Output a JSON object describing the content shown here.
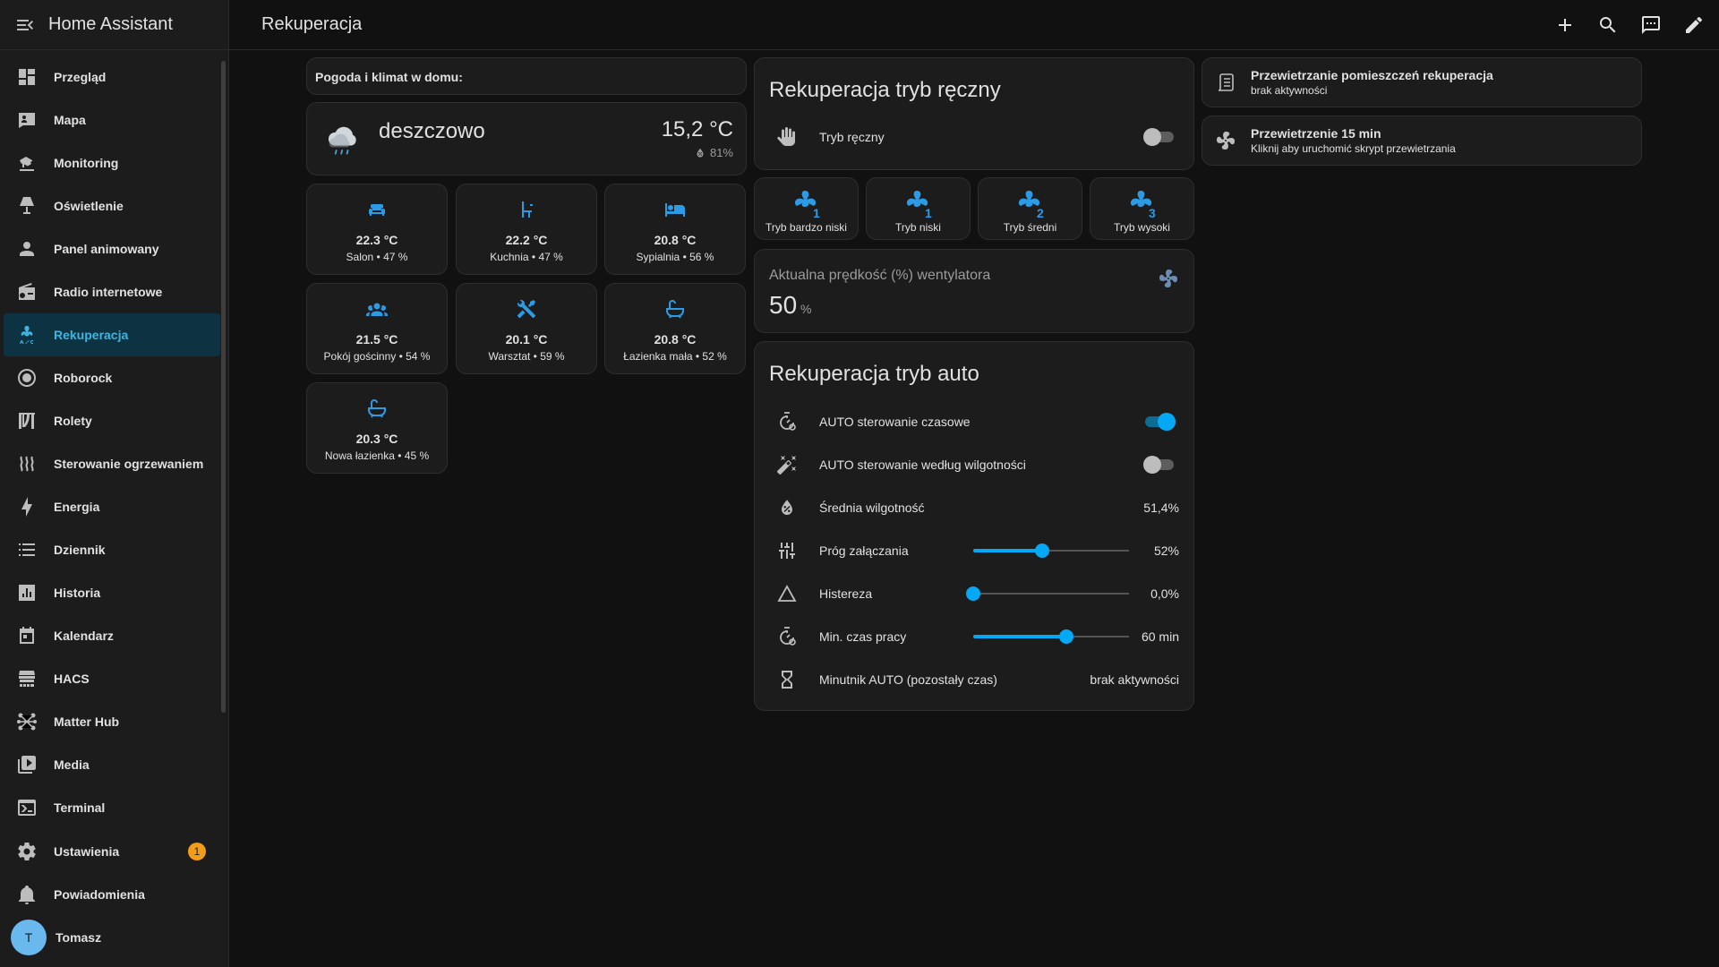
{
  "app": {
    "title": "Home Assistant",
    "page_title": "Rekuperacja"
  },
  "colors": {
    "accent": "#03a9f4",
    "icon_blue": "#2c9be6",
    "badge": "#f29c17",
    "active_bg": "#0d3343"
  },
  "sidebar": {
    "items": [
      {
        "label": "Przegląd",
        "icon": "dashboard-icon"
      },
      {
        "label": "Mapa",
        "icon": "map-icon"
      },
      {
        "label": "Monitoring",
        "icon": "cctv-icon"
      },
      {
        "label": "Oświetlenie",
        "icon": "lamp-icon"
      },
      {
        "label": "Panel animowany",
        "icon": "account-icon"
      },
      {
        "label": "Radio internetowe",
        "icon": "radio-icon"
      },
      {
        "label": "Rekuperacja",
        "icon": "air-conditioner-icon",
        "active": true
      },
      {
        "label": "Roborock",
        "icon": "robot-vacuum-icon"
      },
      {
        "label": "Rolety",
        "icon": "blinds-icon"
      },
      {
        "label": "Sterowanie ogrzewaniem",
        "icon": "heat-wave-icon"
      },
      {
        "label": "Energia",
        "icon": "lightning-icon"
      },
      {
        "label": "Dziennik",
        "icon": "list-icon"
      },
      {
        "label": "Historia",
        "icon": "chart-box-icon"
      },
      {
        "label": "Kalendarz",
        "icon": "calendar-icon"
      },
      {
        "label": "HACS",
        "icon": "hacs-icon"
      },
      {
        "label": "Matter Hub",
        "icon": "hub-icon"
      },
      {
        "label": "Media",
        "icon": "media-icon"
      },
      {
        "label": "Terminal",
        "icon": "terminal-icon"
      }
    ],
    "settings": {
      "label": "Ustawienia",
      "badge": "1"
    },
    "notifications": {
      "label": "Powiadomienia"
    },
    "user": {
      "name": "Tomasz",
      "initial": "T"
    }
  },
  "weather": {
    "header": "Pogoda i klimat w domu:",
    "condition": "deszczowo",
    "temperature": "15,2 °C",
    "humidity": "81%"
  },
  "rooms": [
    {
      "temp": "22.3 °C",
      "sub": "Salon • 47 %",
      "icon": "sofa-icon"
    },
    {
      "temp": "22.2 °C",
      "sub": "Kuchnia • 47 %",
      "icon": "countertop-icon"
    },
    {
      "temp": "20.8 °C",
      "sub": "Sypialnia • 56 %",
      "icon": "bed-icon"
    },
    {
      "temp": "21.5 °C",
      "sub": "Pokój gościnny • 54 %",
      "icon": "guests-icon"
    },
    {
      "temp": "20.1 °C",
      "sub": "Warsztat • 59 %",
      "icon": "tools-icon"
    },
    {
      "temp": "20.8 °C",
      "sub": "Łazienka mała • 52 %",
      "icon": "bathtub-icon"
    },
    {
      "temp": "20.3 °C",
      "sub": "Nowa łazienka • 45 %",
      "icon": "bathtub-icon"
    }
  ],
  "manual": {
    "title": "Rekuperacja tryb ręczny",
    "toggle_label": "Tryb ręczny",
    "toggle_on": false
  },
  "modes": [
    {
      "label": "Tryb bardzo niski",
      "num": "1"
    },
    {
      "label": "Tryb niski",
      "num": "1"
    },
    {
      "label": "Tryb średni",
      "num": "2"
    },
    {
      "label": "Tryb wysoki",
      "num": "3"
    }
  ],
  "fan_speed": {
    "label": "Aktualna prędkość (%) wentylatora",
    "value": "50",
    "unit": "%"
  },
  "auto": {
    "title": "Rekuperacja tryb auto",
    "time_control": {
      "label": "AUTO sterowanie czasowe",
      "on": true
    },
    "humidity_control": {
      "label": "AUTO sterowanie według wilgotności",
      "on": false
    },
    "avg_humidity": {
      "label": "Średnia wilgotność",
      "value": "51,4%"
    },
    "threshold": {
      "label": "Próg załączania",
      "value": "52%",
      "fraction": 0.44
    },
    "hysteresis": {
      "label": "Histereza",
      "value": "0,0%",
      "fraction": 0.0
    },
    "min_time": {
      "label": "Min. czas pracy",
      "value": "60 min",
      "fraction": 0.6
    },
    "timer": {
      "label": "Minutnik AUTO (pozostały czas)",
      "value": "brak aktywności"
    }
  },
  "scripts": [
    {
      "title": "Przewietrzanie pomieszczeń rekuperacja",
      "sub": "brak aktywności",
      "icon": "script-list-icon"
    },
    {
      "title": "Przewietrzenie 15 min",
      "sub": "Kliknij aby uruchomić skrypt przewietrzania",
      "icon": "fan-icon"
    }
  ]
}
